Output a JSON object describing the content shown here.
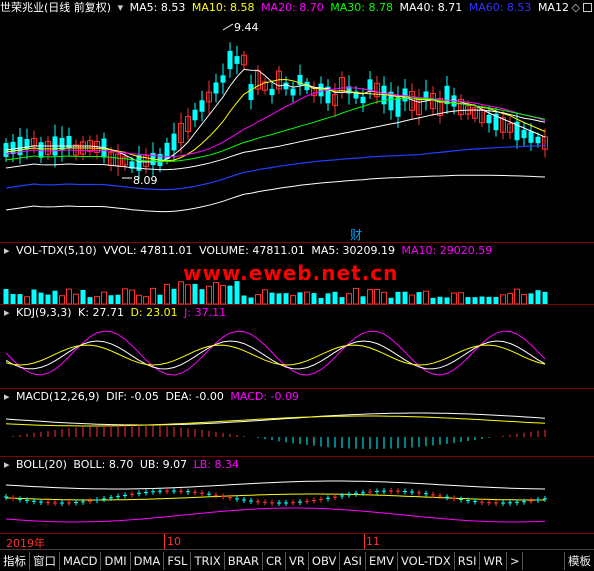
{
  "main_panel": {
    "title": "世荣兆业(日线 前复权)",
    "ma": [
      {
        "label": "MA5: 8.53",
        "color": "#ffffff"
      },
      {
        "label": "MA10: 8.58",
        "color": "#ffff00"
      },
      {
        "label": "MA20: 8.70",
        "color": "#ff00ff"
      },
      {
        "label": "MA30: 8.78",
        "color": "#00ff00"
      },
      {
        "label": "MA40: 8.71",
        "color": "#ffffff"
      },
      {
        "label": "MA60: 8.53",
        "color": "#0000ff"
      },
      {
        "label": "MA12",
        "color": "#ffffff"
      }
    ],
    "max_label": "9.44",
    "min_label": "8.09",
    "event_label": "财"
  },
  "vol_panel": {
    "title": "VOL-TDX(5,10)",
    "vvol": "VVOL: 47811.01",
    "volume": "VOLUME: 47811.01",
    "ma5": "MA5: 30209.19",
    "ma10": "MA10: 29020.59"
  },
  "watermark": "www.eweb.net.cn",
  "kdj_panel": {
    "title": "KDJ(9,3,3)",
    "k": "K: 27.71",
    "d": "D: 23.01",
    "j": "J: 37.11"
  },
  "macd_panel": {
    "title": "MACD(12,26,9)",
    "dif": "DIF: -0.05",
    "dea": "DEA: -0.00",
    "macd": "MACD: -0.09"
  },
  "boll_panel": {
    "title": "BOLL(20)",
    "boll": "BOLL: 8.70",
    "ub": "UB: 9.07",
    "lb": "LB: 8.34"
  },
  "xaxis": {
    "year": "2019年",
    "m10": "10",
    "m11": "11"
  },
  "tabs": [
    "指标",
    "窗口",
    "MACD",
    "DMI",
    "DMA",
    "FSL",
    "TRIX",
    "BRAR",
    "CR",
    "VR",
    "OBV",
    "ASI",
    "EMV",
    "VOL-TDX",
    "RSI",
    "WR",
    ">"
  ],
  "template_tab": "模板",
  "colors": {
    "up": "#ff3232",
    "down": "#00ffff",
    "grid": "#7a0000"
  }
}
